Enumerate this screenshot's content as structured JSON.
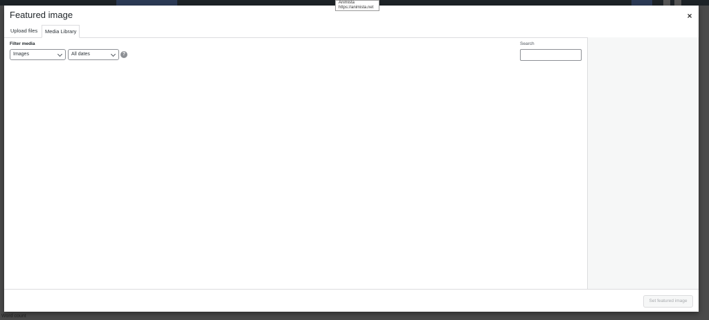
{
  "tooltip": {
    "line1": "Animista",
    "line2": "https://animista.net"
  },
  "modal": {
    "title": "Featured image",
    "close_symbol": "×"
  },
  "tabs": [
    {
      "label": "Upload files",
      "active": false
    },
    {
      "label": "Media Library",
      "active": true
    }
  ],
  "filter": {
    "label": "Filter media",
    "type_selected": "Images",
    "date_selected": "All dates",
    "help_symbol": "?"
  },
  "search": {
    "label": "Search",
    "value": ""
  },
  "toolbar": {
    "set_button_label": "Set featured image"
  },
  "background": {
    "bottom_text": "Word count"
  },
  "colors": {
    "overlay": "#4a4a4a",
    "modal_bg": "#ffffff",
    "sidebar_bg": "#f6f7f7",
    "border": "#dcdcde",
    "disabled_text": "#a7aaad"
  }
}
